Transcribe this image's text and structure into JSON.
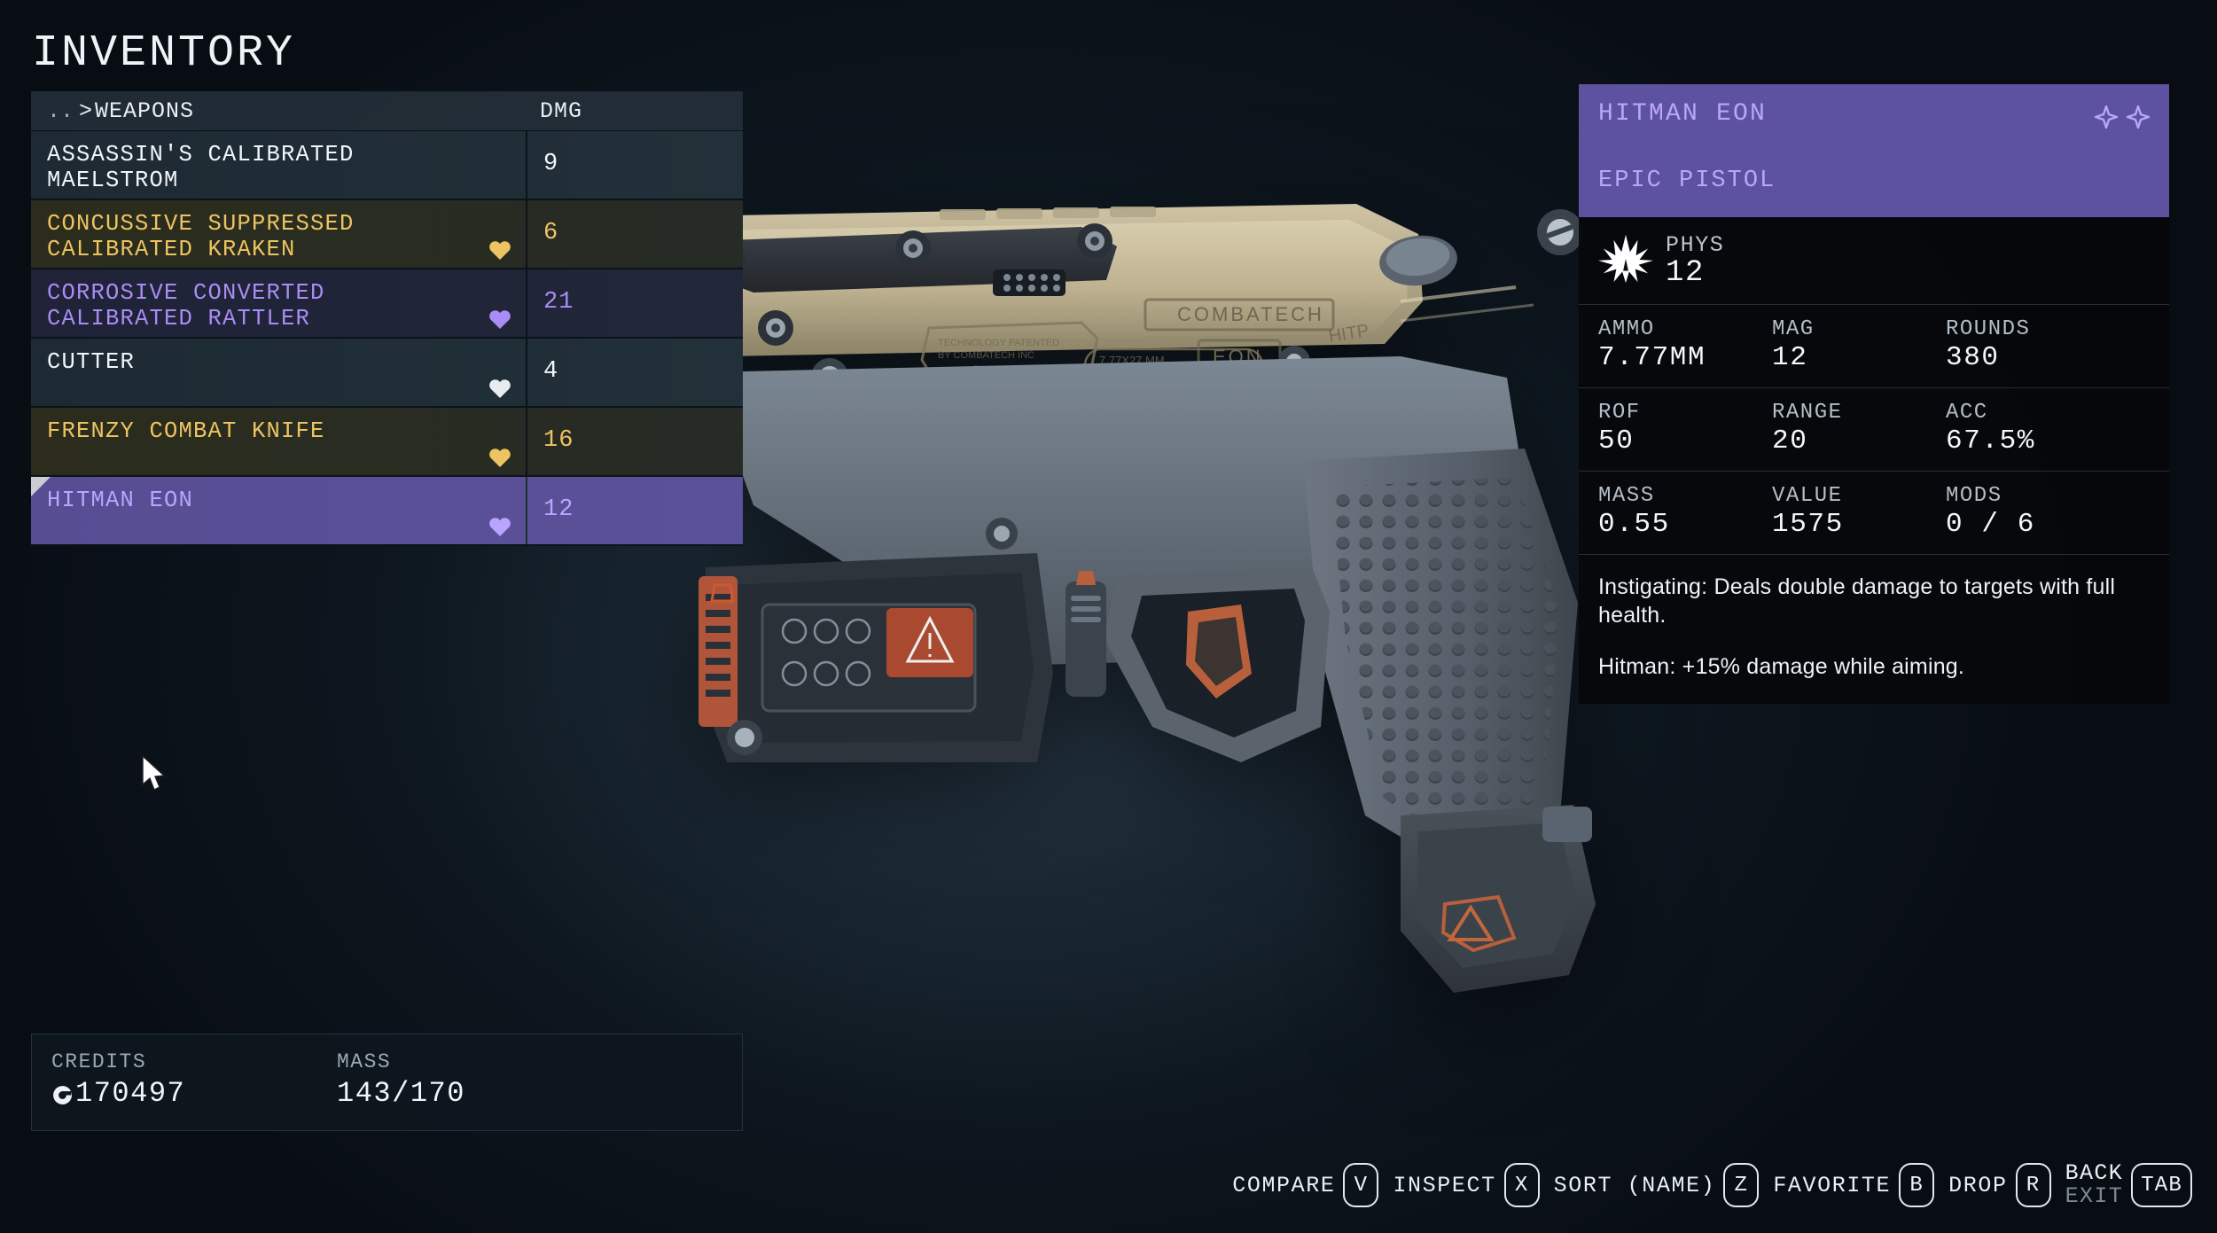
{
  "page_title": "INVENTORY",
  "list": {
    "breadcrumb_dots": "..",
    "breadcrumb_arrow": ">",
    "breadcrumb_category": "WEAPONS",
    "dmg_header": "DMG",
    "rows": [
      {
        "name": "ASSASSIN'S CALIBRATED\nMAELSTROM",
        "dmg": "9",
        "rarity": "common",
        "favorite": false,
        "heart_color": "#e9eef3",
        "selected": false
      },
      {
        "name": "CONCUSSIVE SUPPRESSED\nCALIBRATED KRAKEN",
        "dmg": "6",
        "rarity": "rare",
        "favorite": true,
        "heart_color": "#eec462",
        "selected": false
      },
      {
        "name": "CORROSIVE CONVERTED\nCALIBRATED RATTLER",
        "dmg": "21",
        "rarity": "epic",
        "favorite": true,
        "heart_color": "#a98cf5",
        "selected": false
      },
      {
        "name": "CUTTER",
        "dmg": "4",
        "rarity": "common",
        "favorite": true,
        "heart_color": "#e7ecf1",
        "selected": false
      },
      {
        "name": "FRENZY COMBAT KNIFE",
        "dmg": "16",
        "rarity": "rare",
        "favorite": true,
        "heart_color": "#eec462",
        "selected": false
      },
      {
        "name": "HITMAN EON",
        "dmg": "12",
        "rarity": "epic",
        "favorite": true,
        "heart_color": "#b9a4ff",
        "selected": true
      }
    ]
  },
  "footer": {
    "credits_label": "CREDITS",
    "credits_value": "170497",
    "mass_label": "MASS",
    "mass_value": "143/170"
  },
  "info_panel": {
    "title": "HITMAN EON",
    "subtitle": "EPIC PISTOL",
    "rarity_stars": 2,
    "damage": {
      "type_label": "PHYS",
      "value": "12",
      "icon": "burst-icon"
    },
    "stats": [
      [
        {
          "label": "AMMO",
          "value": "7.77MM"
        },
        {
          "label": "MAG",
          "value": "12"
        },
        {
          "label": "ROUNDS",
          "value": "380"
        }
      ],
      [
        {
          "label": "ROF",
          "value": "50"
        },
        {
          "label": "RANGE",
          "value": "20"
        },
        {
          "label": "ACC",
          "value": "67.5%"
        }
      ],
      [
        {
          "label": "MASS",
          "value": "0.55"
        },
        {
          "label": "VALUE",
          "value": "1575"
        },
        {
          "label": "MODS",
          "value": "0 / 6"
        }
      ]
    ],
    "description": [
      "Instigating: Deals double damage to targets with full health.",
      "Hitman: +15% damage while aiming."
    ]
  },
  "hints": [
    {
      "label": "COMPARE",
      "key": "V"
    },
    {
      "label": "INSPECT",
      "key": "X"
    },
    {
      "label": "SORT (NAME)",
      "key": "Z"
    },
    {
      "label": "FAVORITE",
      "key": "B"
    },
    {
      "label": "DROP",
      "key": "R"
    },
    {
      "label": "BACK",
      "label2": "EXIT",
      "key": "TAB"
    }
  ],
  "colors": {
    "epic": "#a98cf5",
    "rare": "#eec462",
    "common": "#f2f6fa",
    "epic_bg": "#5d52a0"
  }
}
